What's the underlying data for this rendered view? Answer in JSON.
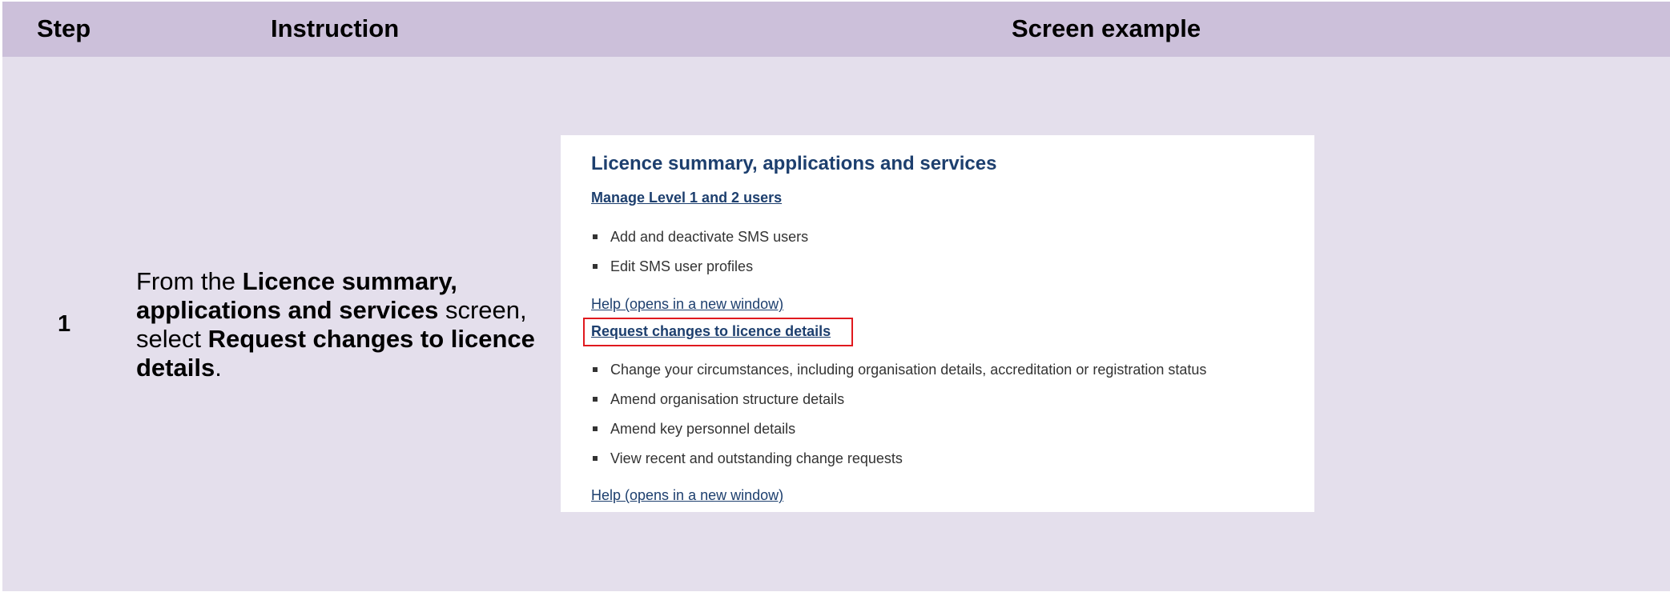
{
  "header": {
    "step": "Step",
    "instruction": "Instruction",
    "screen_example": "Screen example"
  },
  "row": {
    "step_number": "1",
    "instruction": {
      "part1": "From the ",
      "bold1": "Licence summary, applications and services",
      "part2": " screen, select ",
      "bold2": "Request changes to licence details",
      "part3": "."
    }
  },
  "screenshot": {
    "title": "Licence summary, applications and services",
    "manage_link": "Manage Level 1 and 2 users",
    "manage_items": [
      "Add and deactivate SMS users",
      "Edit SMS user profiles"
    ],
    "help_link_1": "Help (opens in a new window)",
    "request_link": "Request changes to licence details",
    "request_items": [
      "Change your circumstances, including organisation details, accreditation or registration status",
      "Amend organisation structure details",
      "Amend key personnel details",
      "View recent and outstanding change requests"
    ],
    "help_link_2": "Help (opens in a new window)",
    "colors": {
      "header_bg": "#ccc0da",
      "row_bg": "#e4dfec",
      "link": "#1d3f6e",
      "highlight": "#e0191e"
    }
  }
}
